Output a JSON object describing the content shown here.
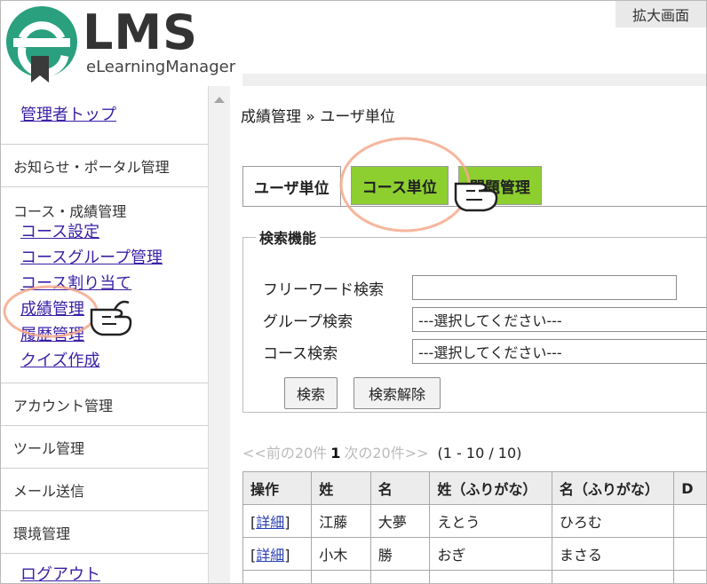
{
  "zoom_label": "拡大画面",
  "logo": {
    "name": "LMS",
    "sub": "eLearningManager"
  },
  "sidebar": {
    "top_link": "管理者トップ",
    "sections": [
      {
        "title": "お知らせ・ポータル管理"
      }
    ],
    "course_group": {
      "title": "コース・成績管理",
      "links": [
        "コース設定",
        "コースグループ管理",
        "コース割り当て",
        "成績管理",
        "履歴管理",
        "クイズ作成"
      ]
    },
    "bottom_sections": [
      "アカウント管理",
      "ツール管理",
      "メール送信",
      "環境管理"
    ],
    "logout": "ログアウト"
  },
  "main": {
    "breadcrumb": "成績管理 » ユーザ単位",
    "tabs": [
      "ユーザ単位",
      "コース単位",
      "問題管理"
    ],
    "search": {
      "legend": "検索機能",
      "freeword_label": "フリーワード検索",
      "freeword_value": "",
      "group_label": "グループ検索",
      "group_value": "---選択してください---",
      "course_label": "コース検索",
      "course_value": "---選択してください---",
      "search_button": "検索",
      "clear_button": "検索解除"
    },
    "pager": {
      "prev": "<<前の20件",
      "current": "1",
      "next": "次の20件>>",
      "range": "(1 - 10 / 10)"
    },
    "table": {
      "headers": [
        "操作",
        "姓",
        "名",
        "姓（ふりがな）",
        "名（ふりがな）",
        "D"
      ],
      "rows": [
        {
          "action": "詳細",
          "last": "江藤",
          "first": "大夢",
          "last_kana": "えとう",
          "first_kana": "ひろむ"
        },
        {
          "action": "詳細",
          "last": "小木",
          "first": "勝",
          "last_kana": "おぎ",
          "first_kana": "まさる"
        }
      ]
    }
  },
  "colors": {
    "accent_green": "#8ccf2f",
    "logo_teal": "#2aa07f",
    "link": "#3a1fa6",
    "annotation": "#f4a98c"
  }
}
